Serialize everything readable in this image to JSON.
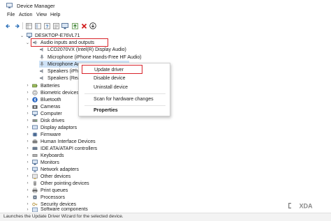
{
  "window": {
    "title": "Device Manager",
    "app_icon": "device-manager-icon"
  },
  "menu": [
    "File",
    "Action",
    "View",
    "Help"
  ],
  "toolbar": {
    "icons": [
      "back-arrow-icon",
      "forward-arrow-icon",
      "properties-grid-icon",
      "console-tree-icon",
      "help-icon",
      "device-properties-icon",
      "monitor-icon",
      "update-driver-icon",
      "uninstall-x-icon",
      "scan-download-icon"
    ]
  },
  "tree": {
    "root": "DESKTOP-E76VL71",
    "expanded_category": "Audio inputs and outputs",
    "audio_children": [
      "LCD2070VX (Intel(R) Display Audio)",
      "Microphone (iPhone Hands-Free HF Audio)",
      "Microphone Ar",
      "Speakers (iPh",
      "Speakers (Realte"
    ],
    "categories": [
      "Batteries",
      "Biometric devices",
      "Bluetooth",
      "Cameras",
      "Computer",
      "Disk drives",
      "Display adaptors",
      "Firmware",
      "Human Interface Devices",
      "IDE ATA/ATAPI controllers",
      "Keyboards",
      "Monitors",
      "Network adapters",
      "Other devices",
      "Other pointing devices",
      "Print queues",
      "Processors",
      "Security devices",
      "Software components"
    ]
  },
  "context_menu": {
    "items": [
      "Update driver",
      "Disable device",
      "Uninstall device",
      "Scan for hardware changes",
      "Properties"
    ]
  },
  "status_bar": "Launches the Update Driver Wizard for the selected device.",
  "watermark": "XDA",
  "colors": {
    "highlight": "#d8232a",
    "selection": "#cfe3f7",
    "accent": "#2a6fb8"
  }
}
